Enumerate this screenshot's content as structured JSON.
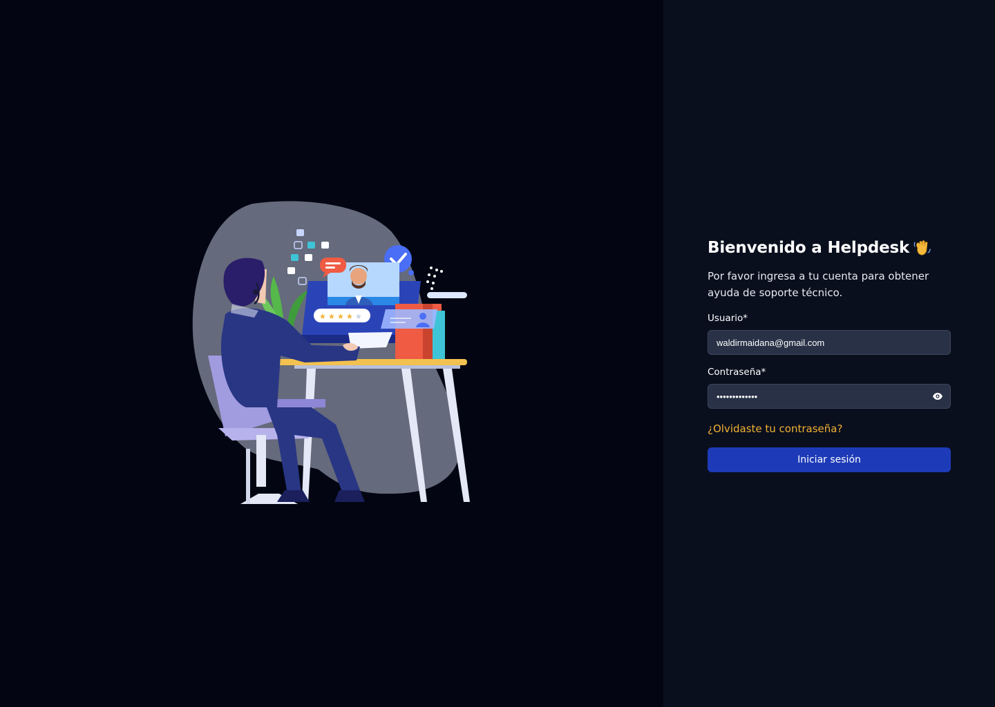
{
  "login": {
    "title": "Bienvenido a Helpdesk",
    "title_emoji": "waving-hand-icon",
    "subtitle": "Por favor ingresa a tu cuenta para obtener ayuda de soporte técnico.",
    "username_label": "Usuario*",
    "username_value": "waldirmaidana@gmail.com",
    "password_label": "Contraseña*",
    "password_value": "•••••••••••••",
    "password_toggle_icon": "eye-icon",
    "forgot_password": "¿Olvidaste tu contraseña?",
    "submit_label": "Iniciar sesión"
  },
  "illustration": {
    "subject": "support-agent-at-desk-illustration",
    "rating_stars": 4,
    "rating_max": 5
  },
  "colors": {
    "left_background": "#030612",
    "right_background": "#0a0f1e",
    "input_background": "#283146",
    "accent_link": "#f2b233",
    "button_primary": "#1d3bb8",
    "blob": "#656a7c"
  }
}
